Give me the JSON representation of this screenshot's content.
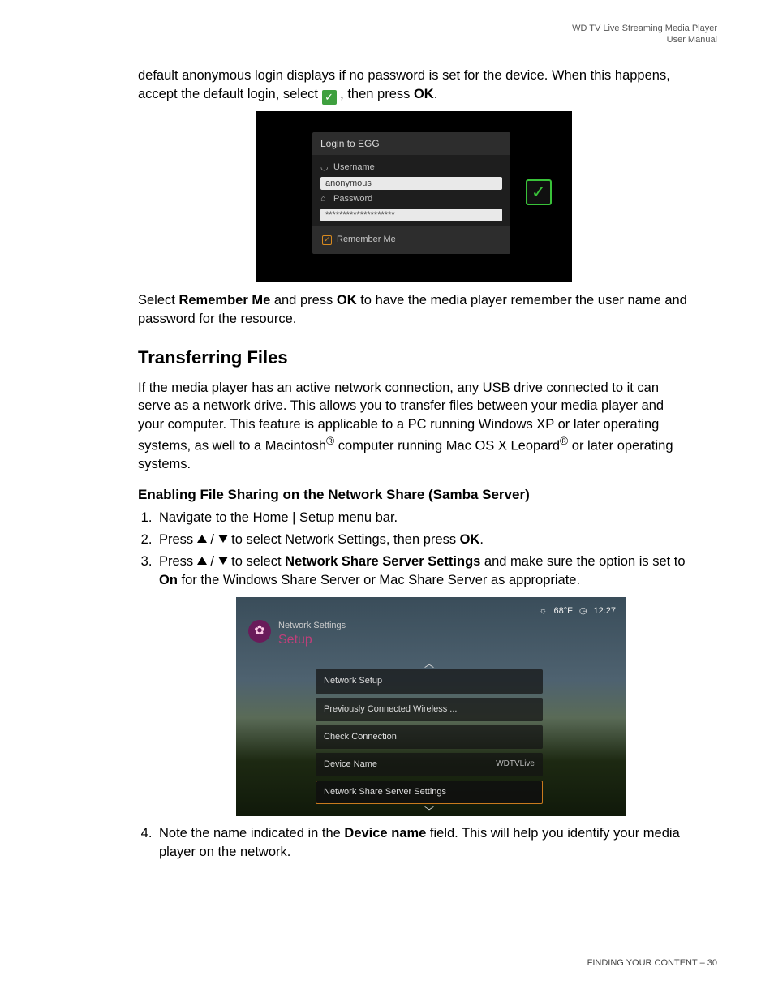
{
  "header": {
    "line1": "WD TV Live Streaming Media Player",
    "line2": "User Manual"
  },
  "p1a": "default anonymous login displays if no password is set for the device. When this happens, accept the default login, select ",
  "p1b": ", then press ",
  "p1c": ".",
  "ok": "OK",
  "shot1": {
    "title": "Login to EGG",
    "username_lbl": "Username",
    "username_val": "anonymous",
    "password_lbl": "Password",
    "password_val": "********************",
    "remember": "Remember Me"
  },
  "p2a": "Select ",
  "p2b": "Remember Me",
  "p2c": " and press ",
  "p2d": " to have the media player remember the user name and password for the resource.",
  "h2": "Transferring Files",
  "p3a": "If the media player has an active network connection, any USB drive connected to it can serve as a network drive. This allows you to transfer files between your media player and your computer. This feature is applicable to a PC running Windows XP or later operating systems, as well to a Macintosh",
  "p3b": " computer running Mac OS X Leopard",
  "p3c": " or later operating systems.",
  "h3": "Enabling File Sharing on the Network Share (Samba Server)",
  "step1": "Navigate to the Home | Setup menu bar.",
  "step2a": "Press ",
  "step2b": " to select Network Settings, then press ",
  "step2c": ".",
  "step3a": "Press ",
  "step3b": " to select ",
  "step3c": "Network Share Server Settings",
  "step3d": " and make sure the option is set to ",
  "step3e": "On",
  "step3f": " for the Windows Share Server or Mac Share Server as appropriate.",
  "shot2": {
    "temp": "68°F",
    "time": "12:27",
    "crumb": "Network Settings",
    "setup": "Setup",
    "items": [
      {
        "label": "Network Setup",
        "value": ""
      },
      {
        "label": "Previously Connected Wireless ...",
        "value": ""
      },
      {
        "label": "Check Connection",
        "value": ""
      },
      {
        "label": "Device Name",
        "value": "WDTVLive"
      },
      {
        "label": "Network Share Server Settings",
        "value": ""
      }
    ]
  },
  "step4a": "Note the name indicated in the ",
  "step4b": "Device name",
  "step4c": " field. This will help you identify your media player on the network.",
  "footer": {
    "section": "FINDING YOUR CONTENT",
    "page": "– 30"
  }
}
